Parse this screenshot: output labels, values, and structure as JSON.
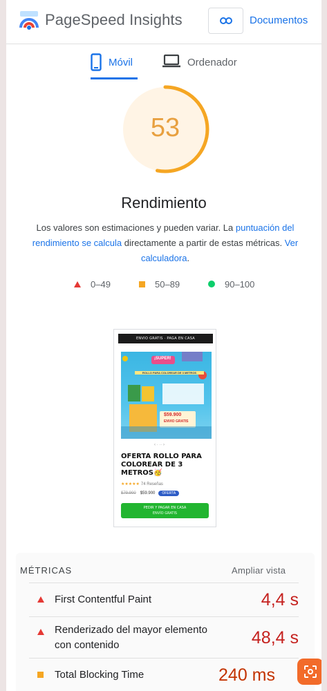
{
  "header": {
    "brand": "PageSpeed Insights",
    "docs_label": "Documentos"
  },
  "tabs": [
    {
      "label": "Móvil",
      "active": true
    },
    {
      "label": "Ordenador",
      "active": false
    }
  ],
  "score": {
    "value": "53",
    "fraction": 0.53,
    "category": "Rendimiento",
    "color": "#f5a623"
  },
  "description": {
    "part1": "Los valores son estimaciones y pueden variar. La ",
    "link1": "puntuación del rendimiento se calcula",
    "part2": " directamente a partir de estas métricas. ",
    "link2": "Ver calculadora",
    "part3": "."
  },
  "legend": [
    {
      "range": "0–49",
      "color": "#e53935",
      "shape": "triangle"
    },
    {
      "range": "50–89",
      "color": "#f5a623",
      "shape": "square"
    },
    {
      "range": "90–100",
      "color": "#0cce6b",
      "shape": "circle"
    }
  ],
  "screenshot": {
    "banner": "ENVIO GRATIS · PAGA EN CASA",
    "product_title": "OFERTA ROLLO PARA COLOREAR DE 3 METROS🥳",
    "stars": "★★★★★",
    "reviews": "74 Reseñas",
    "old_price": "$79.900",
    "price": "$59.900",
    "badge": "OFERTA",
    "cta": "PEDIR Y PAGAR EN CASA",
    "cta_sub": "ENVÍO GRATIS",
    "image_text_top": "¡SUPER!",
    "image_text_mid": "ROLLO PARA COLOREAR DE 3 METROS",
    "image_price": "$59.900",
    "image_free": "ENVIO GRATIS"
  },
  "metrics": {
    "header": "MÉTRICAS",
    "expand_label": "Ampliar vista",
    "items": [
      {
        "name": "First Contentful Paint",
        "value": "4,4 s",
        "rating": "fail"
      },
      {
        "name": "Renderizado del mayor elemento con contenido",
        "value": "48,4 s",
        "rating": "fail"
      },
      {
        "name": "Total Blocking Time",
        "value": "240 ms",
        "rating": "average"
      }
    ]
  },
  "colors": {
    "accent": "#1a73e8",
    "fail": "#c5221f",
    "average": "#f5a623"
  }
}
